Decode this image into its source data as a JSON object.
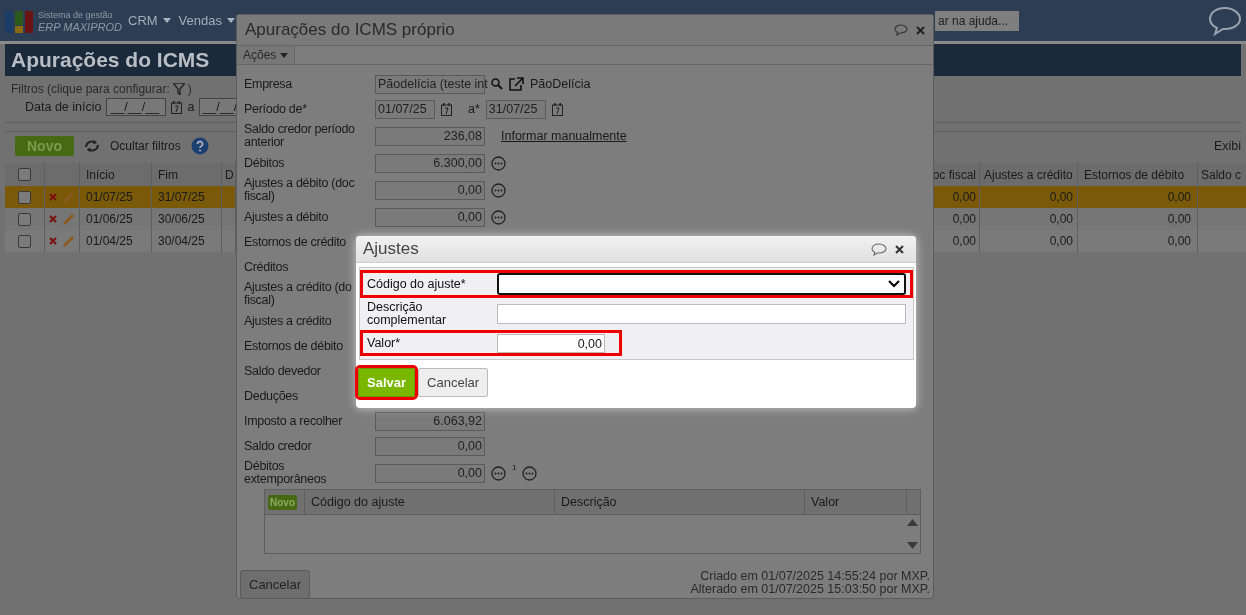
{
  "nav": {
    "logo_line1": "Sistema de gestão",
    "logo_line2": "ERP MAXIPROD",
    "menus": [
      {
        "label": "CRM"
      },
      {
        "label": "Vendas"
      }
    ],
    "search_placeholder": "ar na ajuda..."
  },
  "page": {
    "title": "Apurações do ICMS",
    "filters": {
      "legend": "Filtros (clique para configurar:",
      "legend_end": ")",
      "date_label": "Data de início",
      "date_from": "__/__/__",
      "date_sep": "a",
      "date_to": "__/__/"
    }
  },
  "toolbar": {
    "new_button": "Novo",
    "hide_filters": "Ocultar filtros",
    "display": "Exibi"
  },
  "table": {
    "all_checked": false,
    "columns_left": [
      "Início",
      "Fim",
      "D"
    ],
    "columns_right": [
      "oc fiscal",
      "Ajustes a crédito",
      "Estornos de débito",
      "Saldo c"
    ],
    "rows": [
      {
        "selected": true,
        "checked": false,
        "start": "01/07/25",
        "end": "31/07/25",
        "values": [
          "0,00",
          "0,00",
          "0,00"
        ]
      },
      {
        "selected": false,
        "checked": false,
        "start": "01/06/25",
        "end": "30/06/25",
        "values": [
          "0,00",
          "0,00",
          "0,00"
        ]
      },
      {
        "selected": false,
        "checked": false,
        "start": "01/04/25",
        "end": "30/04/25",
        "values": [
          "0,00",
          "0,00",
          "0,00"
        ]
      }
    ]
  },
  "dialog": {
    "title": "Apurações do ICMS próprio",
    "actions_menu": "Ações",
    "fields": [
      {
        "kind": "company",
        "label": "Empresa",
        "value": "Pãodelícia (teste int",
        "link": "PãoDelícia"
      },
      {
        "kind": "period",
        "label": "Período de*",
        "value": "01/07/25",
        "to_label": "a*",
        "to_value": "31/07/25"
      },
      {
        "kind": "amount",
        "label": "Saldo credor período anterior",
        "value": "236,08",
        "link": "Informar manualmente"
      },
      {
        "kind": "amount",
        "label": "Débitos",
        "value": "6.300,00",
        "details": true
      },
      {
        "kind": "amount",
        "label": "Ajustes a débito (doc fiscal)",
        "value": "0,00",
        "details": true
      },
      {
        "kind": "amount",
        "label": "Ajustes a débito",
        "value": "0,00",
        "details": true
      },
      {
        "kind": "label",
        "label": "Estornos de crédito"
      },
      {
        "kind": "label",
        "label": "Créditos"
      },
      {
        "kind": "label",
        "label": "Ajustes a crédito (do\nfiscal)"
      },
      {
        "kind": "label",
        "label": "Ajustes a crédito"
      },
      {
        "kind": "label",
        "label": "Estornos de débito"
      },
      {
        "kind": "label",
        "label": "Saldo devedor"
      },
      {
        "kind": "label",
        "label": "Deduções"
      },
      {
        "kind": "amount",
        "label": "Imposto a recolher",
        "value": "6.063,92"
      },
      {
        "kind": "amount",
        "label": "Saldo credor",
        "value": "0,00"
      },
      {
        "kind": "amount",
        "label": "Débitos extemporâneos",
        "value": "0,00",
        "details": true,
        "footnote": "1"
      }
    ],
    "grid": {
      "new_button": "Novo",
      "columns": [
        "Código do ajuste",
        "Descrição",
        "Valor"
      ]
    },
    "cancel_button": "Cancelar",
    "created": "Criado em 01/07/2025 14:55:24 por MXP.",
    "altered": "Alterado em 01/07/2025 15:03:50 por MXP."
  },
  "modal": {
    "title": "Ajustes",
    "fields": [
      {
        "kind": "select",
        "label": "Código do ajuste*",
        "highlighted": true
      },
      {
        "kind": "text",
        "label": "Descrição complementar",
        "highlighted": false
      },
      {
        "kind": "number",
        "label": "Valor*",
        "value": "0,00",
        "highlighted": true
      }
    ],
    "buttons": [
      {
        "kind": "primary",
        "label": "Salvar",
        "highlighted": true
      },
      {
        "kind": "secondary",
        "label": "Cancelar",
        "highlighted": false
      }
    ]
  }
}
